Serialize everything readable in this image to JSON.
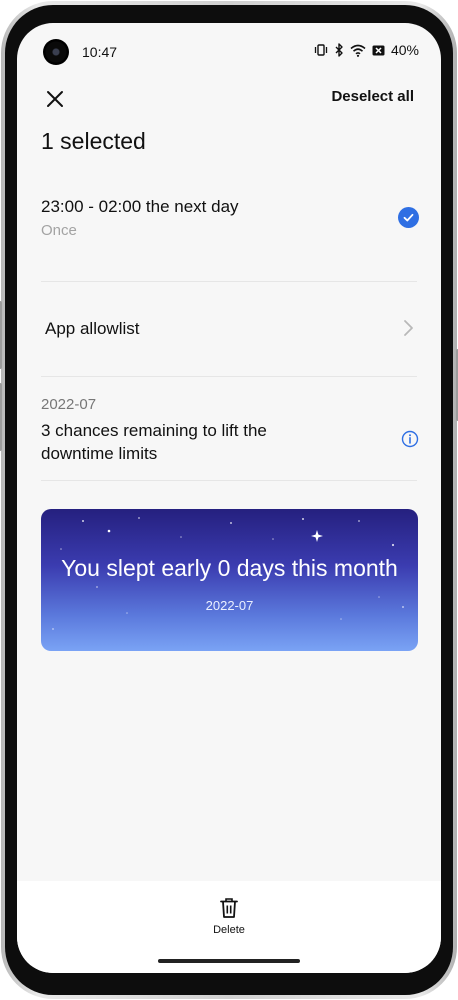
{
  "status_bar": {
    "time": "10:47",
    "battery_percent": "40%",
    "icons": [
      "vibrate-icon",
      "bluetooth-icon",
      "wifi-icon",
      "battery-saver-icon"
    ]
  },
  "header": {
    "close_icon": "close-icon",
    "deselect_all": "Deselect all",
    "title": "1 selected"
  },
  "schedule": {
    "time_range": "23:00 - 02:00 the next day",
    "repeat": "Once",
    "selected": true,
    "accent": "#2f6fe3"
  },
  "allowlist": {
    "label": "App allowlist"
  },
  "limits": {
    "month": "2022-07",
    "chances_text": "3 chances remaining to lift the downtime limits"
  },
  "banner": {
    "title": "You slept early 0 days this month",
    "month": "2022-07"
  },
  "bottom_bar": {
    "delete_label": "Delete"
  }
}
